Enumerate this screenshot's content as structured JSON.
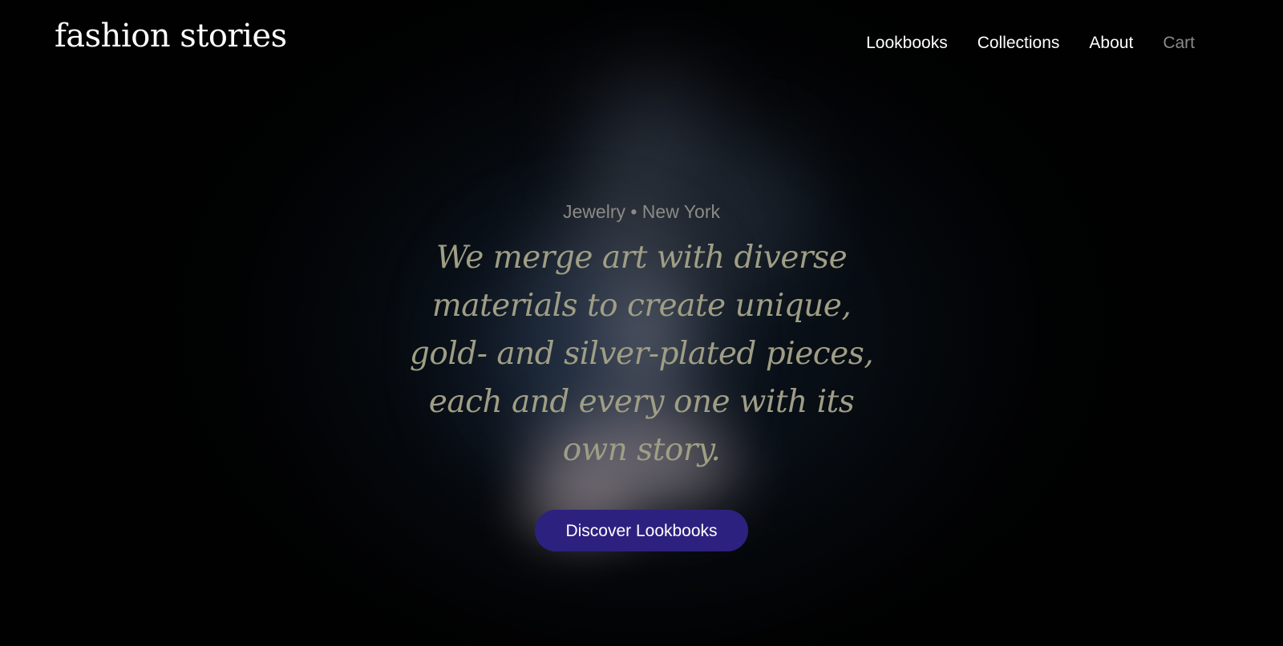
{
  "header": {
    "logo": "fashion stories",
    "nav": [
      {
        "label": "Lookbooks"
      },
      {
        "label": "Collections"
      },
      {
        "label": "About"
      },
      {
        "label": "Cart"
      }
    ]
  },
  "hero": {
    "tagline": "Jewelry • New York",
    "headline": "We merge art with diverse materials to create unique, gold- and silver-plated pieces, each and every one with its own story.",
    "cta_label": "Discover Lookbooks"
  },
  "colors": {
    "background": "#000000",
    "headline": "#9f9e85",
    "tagline": "#8b8a86",
    "cta_background": "#2d2180",
    "nav_text": "#ffffff",
    "nav_muted": "#8a8a8a"
  }
}
